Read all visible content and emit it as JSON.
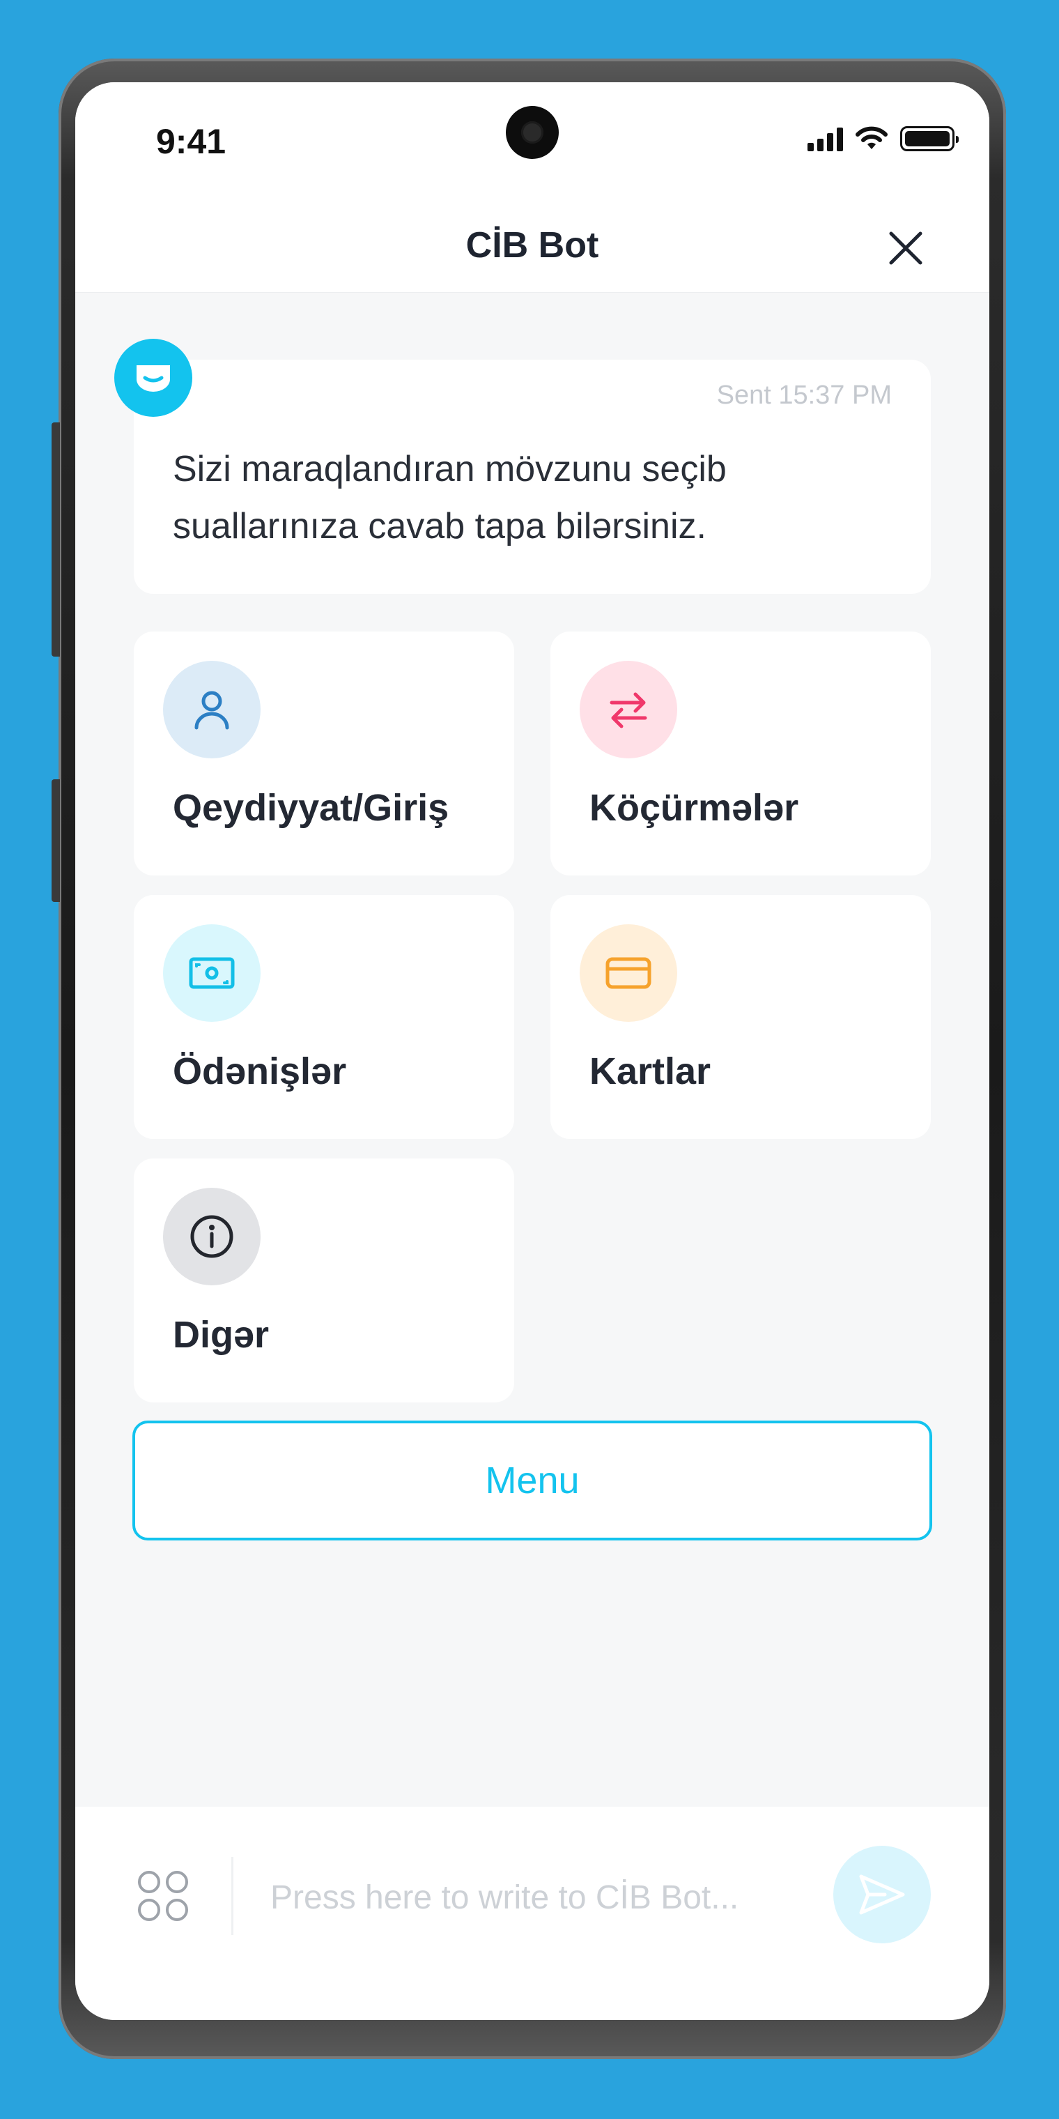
{
  "status_bar": {
    "time": "9:41"
  },
  "header": {
    "title": "CİB Bot"
  },
  "message": {
    "time": "Sent 15:37 PM",
    "text": "Sizi maraqlandıran mövzunu seçib suallarınıza cavab tapa bilərsiniz."
  },
  "topics": [
    {
      "label": "Qeydiyyat/Giriş",
      "icon": "user-icon",
      "icon_bg": "#DCEBF7",
      "icon_color": "#2C7FC4"
    },
    {
      "label": "Köçürmələr",
      "icon": "transfer-arrows-icon",
      "icon_bg": "#FFE0E7",
      "icon_color": "#F0386B"
    },
    {
      "label": "Ödənişlər",
      "icon": "cash-icon",
      "icon_bg": "#D9F7FD",
      "icon_color": "#13BFE7"
    },
    {
      "label": "Kartlar",
      "icon": "credit-card-icon",
      "icon_bg": "#FFEFD9",
      "icon_color": "#F6A22C"
    },
    {
      "label": "Digər",
      "icon": "info-icon",
      "icon_bg": "#E2E3E6",
      "icon_color": "#23262D"
    }
  ],
  "menu": {
    "label": "Menu"
  },
  "composer": {
    "placeholder": "Press here to write to CİB Bot..."
  },
  "colors": {
    "background": "#29A3DD",
    "accent": "#13C3EE"
  }
}
